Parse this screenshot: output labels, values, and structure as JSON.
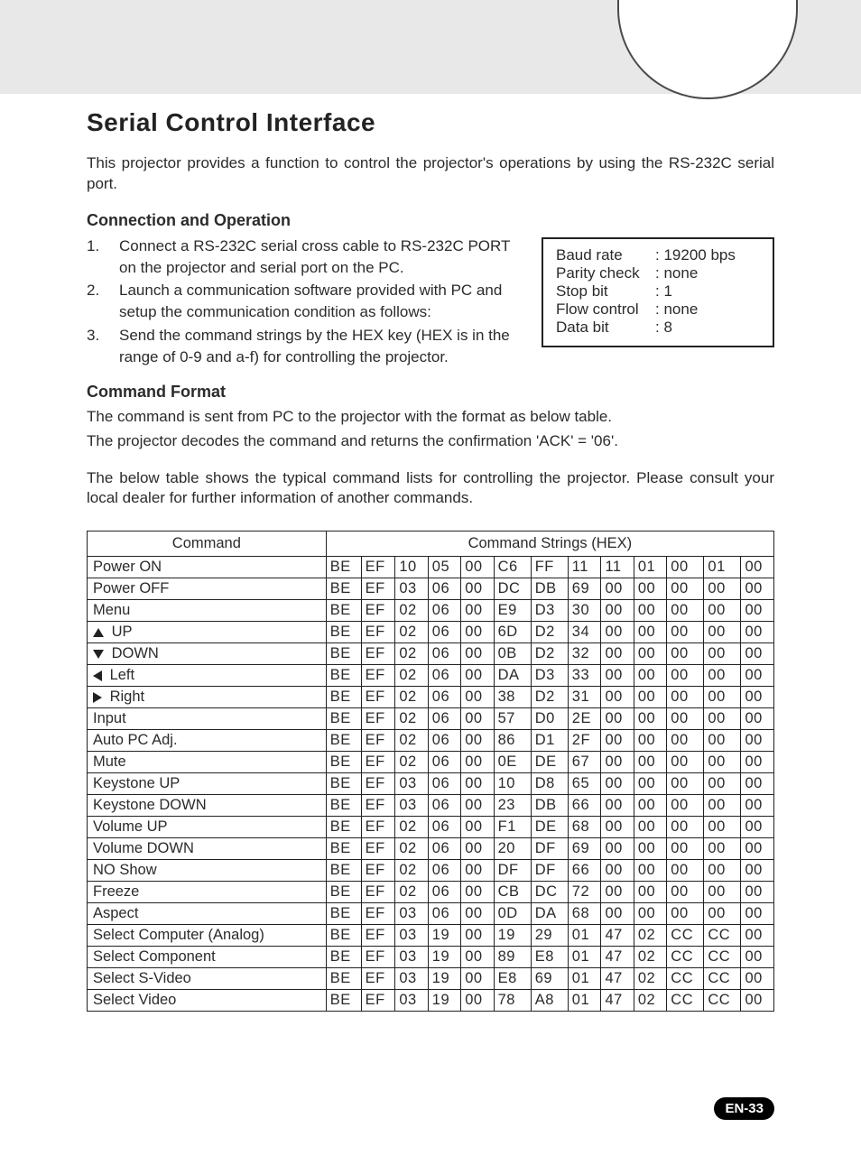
{
  "title": "Serial Control Interface",
  "intro": "This projector provides a function to control the projector's operations by using the RS-232C serial port.",
  "sections": {
    "conn_title": "Connection and Operation",
    "cmd_title": "Command Format"
  },
  "steps": [
    {
      "num": "1.",
      "text": "Connect a RS-232C serial cross cable to RS-232C PORT on the projector and serial port on the PC."
    },
    {
      "num": "2.",
      "text": "Launch a communication software provided with PC and setup the communication condition as follows:"
    },
    {
      "num": "3.",
      "text": "Send the command strings by the HEX key (HEX is in the range of 0-9 and a-f) for controlling the projector."
    }
  ],
  "comm_params": [
    {
      "label": "Baud rate",
      "value": "19200 bps"
    },
    {
      "label": "Parity check",
      "value": "none"
    },
    {
      "label": "Stop bit",
      "value": "1"
    },
    {
      "label": "Flow control",
      "value": "none"
    },
    {
      "label": "Data bit",
      "value": "8"
    }
  ],
  "cmd_desc1": "The command is sent from PC to the projector with the format as below table.",
  "cmd_desc2": "The projector decodes the command and returns the confirmation 'ACK' = '06'.",
  "cmd_desc3": "The below table shows the typical command lists for controlling the projector. Please consult your local dealer for further information of another commands.",
  "table": {
    "head_cmd": "Command",
    "head_hex": "Command Strings (HEX)",
    "rows": [
      {
        "icon": "",
        "label": "Power ON",
        "hex": [
          "BE",
          "EF",
          "10",
          "05",
          "00",
          "C6",
          "FF",
          "11",
          "11",
          "01",
          "00",
          "01",
          "00"
        ]
      },
      {
        "icon": "",
        "label": "Power OFF",
        "hex": [
          "BE",
          "EF",
          "03",
          "06",
          "00",
          "DC",
          "DB",
          "69",
          "00",
          "00",
          "00",
          "00",
          "00"
        ]
      },
      {
        "icon": "",
        "label": "Menu",
        "hex": [
          "BE",
          "EF",
          "02",
          "06",
          "00",
          "E9",
          "D3",
          "30",
          "00",
          "00",
          "00",
          "00",
          "00"
        ]
      },
      {
        "icon": "up",
        "label": "UP",
        "hex": [
          "BE",
          "EF",
          "02",
          "06",
          "00",
          "6D",
          "D2",
          "34",
          "00",
          "00",
          "00",
          "00",
          "00"
        ]
      },
      {
        "icon": "down",
        "label": "DOWN",
        "hex": [
          "BE",
          "EF",
          "02",
          "06",
          "00",
          "0B",
          "D2",
          "32",
          "00",
          "00",
          "00",
          "00",
          "00"
        ]
      },
      {
        "icon": "left",
        "label": "Left",
        "hex": [
          "BE",
          "EF",
          "02",
          "06",
          "00",
          "DA",
          "D3",
          "33",
          "00",
          "00",
          "00",
          "00",
          "00"
        ]
      },
      {
        "icon": "right",
        "label": "Right",
        "hex": [
          "BE",
          "EF",
          "02",
          "06",
          "00",
          "38",
          "D2",
          "31",
          "00",
          "00",
          "00",
          "00",
          "00"
        ]
      },
      {
        "icon": "",
        "label": "Input",
        "hex": [
          "BE",
          "EF",
          "02",
          "06",
          "00",
          "57",
          "D0",
          "2E",
          "00",
          "00",
          "00",
          "00",
          "00"
        ]
      },
      {
        "icon": "",
        "label": "Auto PC Adj.",
        "hex": [
          "BE",
          "EF",
          "02",
          "06",
          "00",
          "86",
          "D1",
          "2F",
          "00",
          "00",
          "00",
          "00",
          "00"
        ]
      },
      {
        "icon": "",
        "label": "Mute",
        "hex": [
          "BE",
          "EF",
          "02",
          "06",
          "00",
          "0E",
          "DE",
          "67",
          "00",
          "00",
          "00",
          "00",
          "00"
        ]
      },
      {
        "icon": "",
        "label": "Keystone UP",
        "hex": [
          "BE",
          "EF",
          "03",
          "06",
          "00",
          "10",
          "D8",
          "65",
          "00",
          "00",
          "00",
          "00",
          "00"
        ]
      },
      {
        "icon": "",
        "label": "Keystone DOWN",
        "hex": [
          "BE",
          "EF",
          "03",
          "06",
          "00",
          "23",
          "DB",
          "66",
          "00",
          "00",
          "00",
          "00",
          "00"
        ]
      },
      {
        "icon": "",
        "label": "Volume UP",
        "hex": [
          "BE",
          "EF",
          "02",
          "06",
          "00",
          "F1",
          "DE",
          "68",
          "00",
          "00",
          "00",
          "00",
          "00"
        ]
      },
      {
        "icon": "",
        "label": "Volume DOWN",
        "hex": [
          "BE",
          "EF",
          "02",
          "06",
          "00",
          "20",
          "DF",
          "69",
          "00",
          "00",
          "00",
          "00",
          "00"
        ]
      },
      {
        "icon": "",
        "label": "NO Show",
        "hex": [
          "BE",
          "EF",
          "02",
          "06",
          "00",
          "DF",
          "DF",
          "66",
          "00",
          "00",
          "00",
          "00",
          "00"
        ]
      },
      {
        "icon": "",
        "label": "Freeze",
        "hex": [
          "BE",
          "EF",
          "02",
          "06",
          "00",
          "CB",
          "DC",
          "72",
          "00",
          "00",
          "00",
          "00",
          "00"
        ]
      },
      {
        "icon": "",
        "label": "Aspect",
        "hex": [
          "BE",
          "EF",
          "03",
          "06",
          "00",
          "0D",
          "DA",
          "68",
          "00",
          "00",
          "00",
          "00",
          "00"
        ]
      },
      {
        "icon": "",
        "label": "Select Computer (Analog)",
        "hex": [
          "BE",
          "EF",
          "03",
          "19",
          "00",
          "19",
          "29",
          "01",
          "47",
          "02",
          "CC",
          "CC",
          "00"
        ]
      },
      {
        "icon": "",
        "label": "Select Component",
        "hex": [
          "BE",
          "EF",
          "03",
          "19",
          "00",
          "89",
          "E8",
          "01",
          "47",
          "02",
          "CC",
          "CC",
          "00"
        ]
      },
      {
        "icon": "",
        "label": "Select S-Video",
        "hex": [
          "BE",
          "EF",
          "03",
          "19",
          "00",
          "E8",
          "69",
          "01",
          "47",
          "02",
          "CC",
          "CC",
          "00"
        ]
      },
      {
        "icon": "",
        "label": "Select Video",
        "hex": [
          "BE",
          "EF",
          "03",
          "19",
          "00",
          "78",
          "A8",
          "01",
          "47",
          "02",
          "CC",
          "CC",
          "00"
        ]
      }
    ]
  },
  "page_number": "EN-33"
}
